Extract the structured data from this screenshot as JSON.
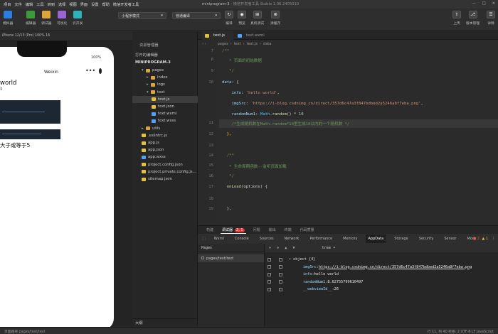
{
  "menubar": {
    "items": [
      "项目",
      "文件",
      "编辑",
      "工具",
      "转到",
      "选择",
      "视图",
      "界面",
      "设置",
      "帮助",
      "微信开发者工具"
    ],
    "title": "miniprogram-3",
    "title_sub": " - 微信开发者工具 Stable 1.06.2405010"
  },
  "toolbar": {
    "left_buttons": [
      "模拟器",
      "编辑器",
      "调试器",
      "可视化",
      "云开发"
    ],
    "mode_select": "小程序模式",
    "compile_select": "普通编译",
    "mid_buttons": [
      "编译",
      "预览",
      "真机调试",
      "清缓存"
    ],
    "right_buttons": [
      "上传",
      "版本管理",
      "详情"
    ]
  },
  "simulator": {
    "device": "iPhone 12/13 (Pro) 100% 16",
    "battery": "100%",
    "nav_title": "Weixin",
    "heading": "world",
    "heading_sub": "名",
    "big_text": "大于或等于5"
  },
  "explorer": {
    "header": "资源管理器",
    "open_editors": "打开的编辑器",
    "project": "MINIPROGRAM-3",
    "tree": [
      {
        "label": "pages",
        "depth": 1,
        "type": "folder",
        "open": true
      },
      {
        "label": "index",
        "depth": 2,
        "type": "folder",
        "open": false
      },
      {
        "label": "logs",
        "depth": 2,
        "type": "folder",
        "open": false
      },
      {
        "label": "text",
        "depth": 2,
        "type": "folder",
        "open": true
      },
      {
        "label": "text.js",
        "depth": 3,
        "type": "js",
        "selected": true
      },
      {
        "label": "text.json",
        "depth": 3,
        "type": "json"
      },
      {
        "label": "text.wxml",
        "depth": 3,
        "type": "wxml"
      },
      {
        "label": "text.wxss",
        "depth": 3,
        "type": "wxss"
      },
      {
        "label": "utils",
        "depth": 1,
        "type": "folder",
        "open": false
      },
      {
        "label": ".eslintrc.js",
        "depth": 1,
        "type": "js"
      },
      {
        "label": "app.js",
        "depth": 1,
        "type": "js"
      },
      {
        "label": "app.json",
        "depth": 1,
        "type": "json"
      },
      {
        "label": "app.wxss",
        "depth": 1,
        "type": "wxss"
      },
      {
        "label": "project.config.json",
        "depth": 1,
        "type": "json"
      },
      {
        "label": "project.private.config.js...",
        "depth": 1,
        "type": "json"
      },
      {
        "label": "sitemap.json",
        "depth": 1,
        "type": "json"
      }
    ],
    "outline": "大纲"
  },
  "editor": {
    "tabs": [
      "text.js",
      "text.wxml"
    ],
    "breadcrumb": [
      "pages",
      "text",
      "text.js",
      "data"
    ],
    "lines": [
      {
        "n": "7",
        "t": [
          [
            "/**",
            "c"
          ]
        ]
      },
      {
        "n": "8",
        "t": [
          [
            "   * 页面的初始数据",
            "c"
          ]
        ]
      },
      {
        "n": "9",
        "t": [
          [
            "   */",
            "c"
          ]
        ]
      },
      {
        "n": "10",
        "t": [
          [
            "data",
            "p"
          ],
          [
            ": {",
            "w"
          ]
        ]
      },
      {
        "n": "",
        "t": [
          [
            "    info",
            "p"
          ],
          [
            ": ",
            "w"
          ],
          [
            "'hello world'",
            "s"
          ],
          [
            ",",
            "w"
          ]
        ]
      },
      {
        "n": "",
        "t": [
          [
            "    imgSrc",
            "p"
          ],
          [
            ": ",
            "w"
          ],
          [
            "'https://i-blog.csdnimg.cn/direct/357d6c47a3f847bdbed2a5246a8f7eba.png'",
            "s"
          ],
          [
            ",",
            "w"
          ]
        ]
      },
      {
        "n": "",
        "t": [
          [
            "    randomNum1",
            "p"
          ],
          [
            ": ",
            "w"
          ],
          [
            "Math",
            "f"
          ],
          [
            ".",
            "w"
          ],
          [
            "random",
            "k"
          ],
          [
            "() * ",
            "w"
          ],
          [
            "10",
            "n"
          ]
        ]
      },
      {
        "n": "11",
        "t": [
          [
            "    /*生成随机数在Math.random*10里生成10以内的一个随机数 */",
            "c"
          ]
        ]
      },
      {
        "n": "12",
        "t": [
          [
            "  },",
            "y"
          ]
        ]
      },
      {
        "n": "13",
        "t": [
          [
            "",
            "w"
          ]
        ]
      },
      {
        "n": "14",
        "t": [
          [
            "  /**",
            "c"
          ]
        ]
      },
      {
        "n": "15",
        "t": [
          [
            "   * 生命周期函数--监听页面加载",
            "c"
          ]
        ]
      },
      {
        "n": "16",
        "t": [
          [
            "   */",
            "c"
          ]
        ]
      },
      {
        "n": "17",
        "t": [
          [
            "  ",
            "w"
          ],
          [
            "onLoad",
            "k"
          ],
          [
            "(options) {",
            "w"
          ]
        ]
      },
      {
        "n": "18",
        "t": [
          [
            "",
            "w"
          ]
        ]
      },
      {
        "n": "19",
        "t": [
          [
            "  },",
            "w"
          ]
        ]
      }
    ]
  },
  "devtools": {
    "top_tabs": [
      "构建",
      "调试器",
      "问题",
      "输出",
      "终端",
      "代码质量"
    ],
    "badge": "2, 1",
    "panel_tabs": [
      "Wxml",
      "Console",
      "Sources",
      "Network",
      "Performance",
      "Memory",
      "AppData",
      "Storage",
      "Security",
      "Sensor",
      "Mock"
    ],
    "errors": "2",
    "warnings": "1",
    "tree_select": "tree",
    "pages_header": "Pages",
    "page_item": "pages/text/text",
    "appdata": [
      {
        "key": "object {4}",
        "val": "",
        "indent": 0
      },
      {
        "key": "imgSrc",
        "val": "https://i-blog.csdnimg.cn/direct/357d6c47a3f847bdbed2a5246a8f7eba.png",
        "indent": 1,
        "link": true
      },
      {
        "key": "info",
        "val": "hello world",
        "indent": 1
      },
      {
        "key": "randomNum1",
        "val": "8.62755799610497",
        "indent": 1
      },
      {
        "key": "__webviewId__",
        "val": "26",
        "indent": 1
      }
    ]
  },
  "statusbar": {
    "left": "页面路径  pages/text/text",
    "right": "行 11, 列 40   空格: 2   UTF-8   LF   JavaScript"
  }
}
